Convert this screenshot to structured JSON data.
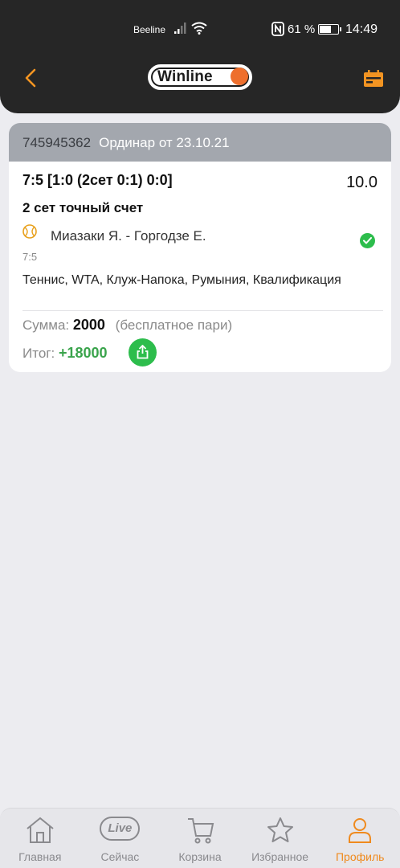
{
  "status_bar": {
    "carrier": "Beeline",
    "battery": "61 %",
    "time": "14:49"
  },
  "header": {
    "logo_text": "Winline",
    "colors": {
      "accent": "#ee6f2d",
      "bar": "#262626"
    }
  },
  "bet": {
    "id": "745945362",
    "type": "Ординар от 23.10.21",
    "score_line": "7:5 [1:0 (2сет 0:1) 0:0]",
    "coefficient": "10.0",
    "market": "2 сет точный счет",
    "match": "Миазаки Я. - Горгодзе Е.",
    "score": "7:5",
    "tournament": "Теннис,  WTA, Клуж-Напока, Румыния, Квалификация",
    "sum_label": "Сумма:",
    "sum_value": "2000",
    "sum_note": "(бесплатное пари)",
    "total_label": "Итог:",
    "total_value": "+18000",
    "status": "won"
  },
  "tabs": [
    {
      "label": "Главная",
      "icon": "home-icon",
      "active": false
    },
    {
      "label": "Сейчас",
      "icon": "live-icon",
      "badge": "Live",
      "active": false
    },
    {
      "label": "Корзина",
      "icon": "cart-icon",
      "active": false
    },
    {
      "label": "Избранное",
      "icon": "star-icon",
      "active": false
    },
    {
      "label": "Профиль",
      "icon": "profile-icon",
      "active": true
    }
  ]
}
